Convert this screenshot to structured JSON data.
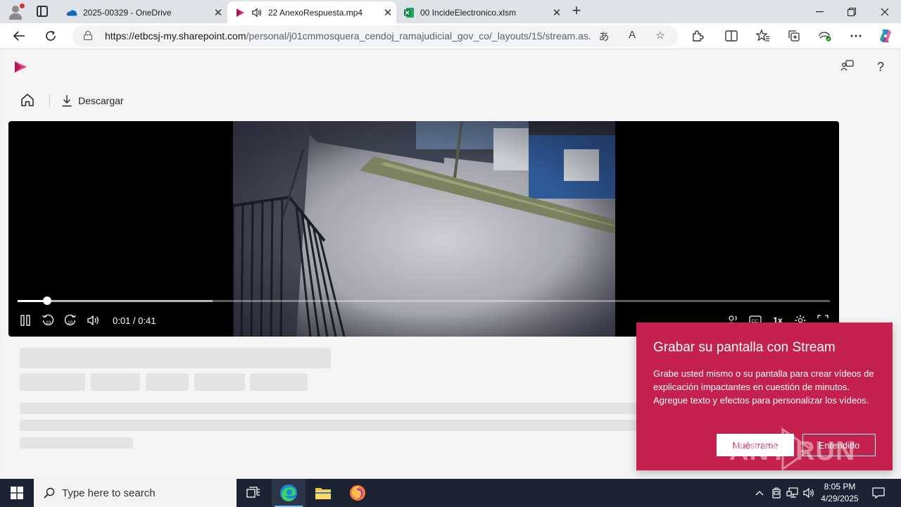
{
  "browser": {
    "tabs": [
      {
        "label": "2025-00329 - OneDrive",
        "icon": "onedrive-icon",
        "active": false
      },
      {
        "label": "22 AnexoRespuesta.mp4",
        "icon": "stream-icon",
        "active": true,
        "audio": true
      },
      {
        "label": "00 IncideElectronico.xlsm",
        "icon": "excel-icon",
        "active": false
      }
    ],
    "url_host": "https://etbcsj-my.sharepoint.com",
    "url_path": "/personal/j01cmmosquera_cendoj_ramajudicial_gov_co/_layouts/15/stream.as...",
    "colors": {
      "tabstrip": "#dfe3e8",
      "accent": "#0f6cbd"
    }
  },
  "app": {
    "command_bar": {
      "download_label": "Descargar"
    },
    "colors": {
      "brand": "#c4214f",
      "logo": "#d6336c"
    }
  },
  "player": {
    "current_time": "0:01",
    "duration": "0:41",
    "time_display": "0:01 / 0:41",
    "progress_fraction": 0.036,
    "buffered_fraction": 0.24,
    "playback_rate": "1x",
    "state": "playing"
  },
  "popup": {
    "title": "Grabar su pantalla con Stream",
    "body": "Grabe usted mismo o su pantalla para crear vídeos de explicación impactantes en cuestión de minutos. Agregue texto y efectos para personalizar los vídeos.",
    "primary_label": "Muéstrame",
    "secondary_label": "Entendido",
    "color": "#c4214f"
  },
  "watermark": {
    "text": "ANY RUN"
  },
  "taskbar": {
    "search_placeholder": "Type here to search",
    "time": "8:05 PM",
    "date": "4/29/2025",
    "color": "#1c2433"
  }
}
